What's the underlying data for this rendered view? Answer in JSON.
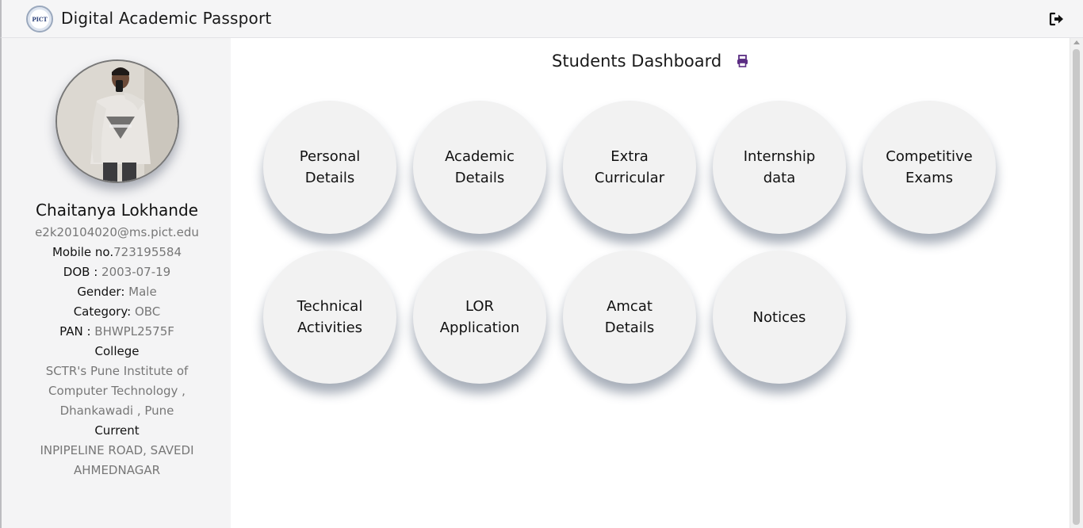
{
  "header": {
    "logo_text": "PICT",
    "title": "Digital Academic Passport",
    "logout_icon": "sign-out-icon"
  },
  "profile": {
    "name": "Chaitanya Lokhande",
    "email": "e2k20104020@ms.pict.edu",
    "mobile_label": "Mobile no.",
    "mobile": "723195584",
    "dob_label": "DOB",
    "dob": "2003-07-19",
    "gender_label": "Gender",
    "gender": "Male",
    "category_label": "Category",
    "category": "OBC",
    "pan_label": "PAN",
    "pan": "BHWPL2575F",
    "college_label": "College",
    "college": "SCTR's Pune Institute of Computer Technology , Dhankawadi , Pune",
    "current_label": "Current",
    "current_address": "INPIPELINE ROAD, SAVEDI AHMEDNAGAR"
  },
  "dashboard": {
    "title": "Students Dashboard",
    "print_icon": "print-icon",
    "print_color": "#5b2d83",
    "tiles": [
      {
        "label": "Personal Details"
      },
      {
        "label": "Academic Details"
      },
      {
        "label": "Extra Curricular"
      },
      {
        "label": "Internship data"
      },
      {
        "label": "Competitive Exams"
      },
      {
        "label": "Technical Activities"
      },
      {
        "label": "LOR Application"
      },
      {
        "label": "Amcat Details"
      },
      {
        "label": "Notices"
      }
    ]
  }
}
